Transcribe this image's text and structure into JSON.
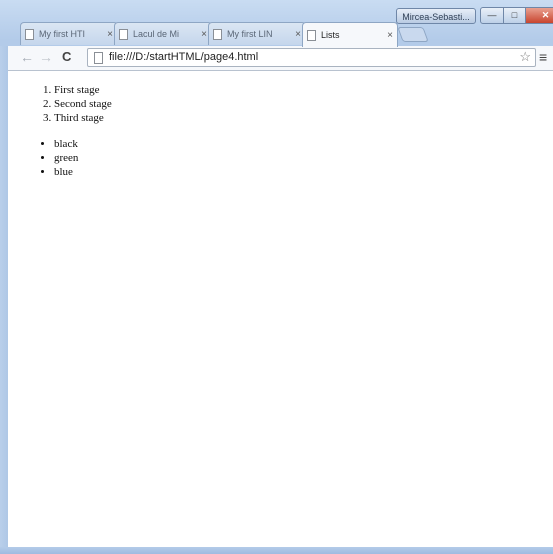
{
  "titlebar": {
    "profile_name": "Mircea-Sebasti...",
    "minimize_glyph": "—",
    "maximize_glyph": "□",
    "close_glyph": "✕"
  },
  "tabs": [
    {
      "title": "My first HTI",
      "close": "×",
      "active": false
    },
    {
      "title": "Lacul de Mi",
      "close": "×",
      "active": false
    },
    {
      "title": "My first LIN",
      "close": "×",
      "active": false
    },
    {
      "title": "Lists",
      "close": "×",
      "active": true
    }
  ],
  "toolbar": {
    "back": "←",
    "forward": "→",
    "reload": "C",
    "url": "file:///D:/startHTML/page4.html",
    "star": "☆",
    "menu": "≡"
  },
  "page": {
    "ordered_list": [
      "First stage",
      "Second stage",
      "Third stage"
    ],
    "unordered_list": [
      "black",
      "green",
      "blue"
    ]
  }
}
